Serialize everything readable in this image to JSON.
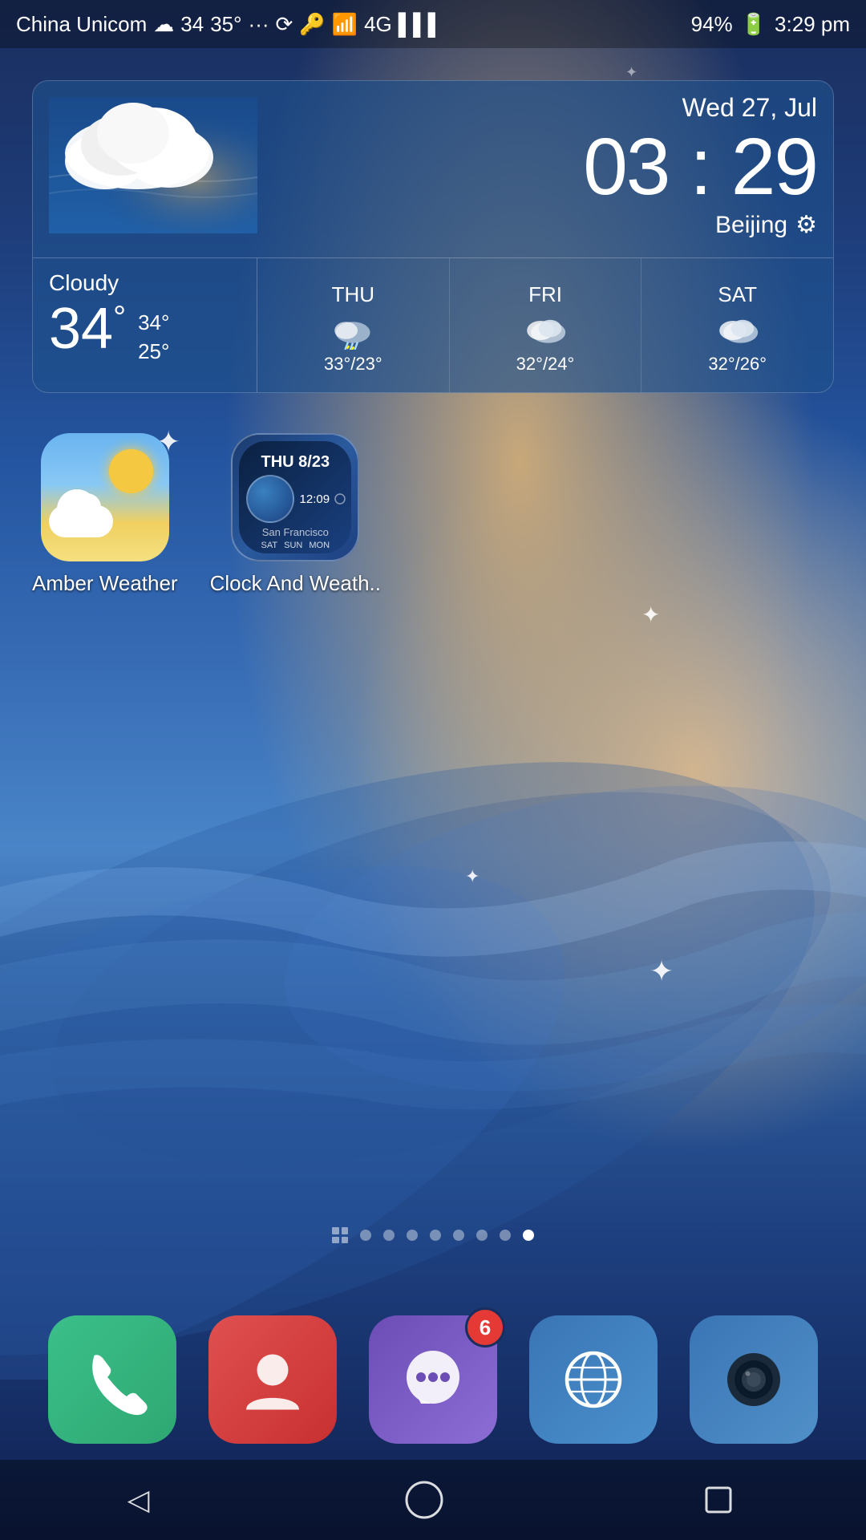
{
  "statusBar": {
    "carrier": "China Unicom",
    "weatherIcon": "☁",
    "temp": "34",
    "tempHigh": "35°",
    "dots": "···",
    "battery": "94%",
    "time": "3:29 pm"
  },
  "weatherWidget": {
    "date": "Wed 27, Jul",
    "time": "03 : 29",
    "location": "Beijing",
    "condition": "Cloudy",
    "currentTemp": "34",
    "highTemp": "34°",
    "lowTemp": "25°",
    "forecast": [
      {
        "day": "THU",
        "icon": "⛈",
        "temps": "33°/23°"
      },
      {
        "day": "FRI",
        "icon": "☁",
        "temps": "32°/24°"
      },
      {
        "day": "SAT",
        "icon": "☁",
        "temps": "32°/26°"
      }
    ]
  },
  "apps": [
    {
      "name": "Amber Weather",
      "type": "amber"
    },
    {
      "name": "Clock And Weath..",
      "type": "clock"
    }
  ],
  "pageIndicators": {
    "total": 8,
    "activeIndex": 7
  },
  "dock": [
    {
      "name": "Phone",
      "type": "phone",
      "badge": null
    },
    {
      "name": "Contacts",
      "type": "contacts",
      "badge": null
    },
    {
      "name": "Messages",
      "type": "messages",
      "badge": "6"
    },
    {
      "name": "Browser",
      "type": "browser",
      "badge": null
    },
    {
      "name": "Camera",
      "type": "camera",
      "badge": null
    }
  ],
  "navBar": {
    "back": "◁",
    "home": "○",
    "recent": "□"
  }
}
